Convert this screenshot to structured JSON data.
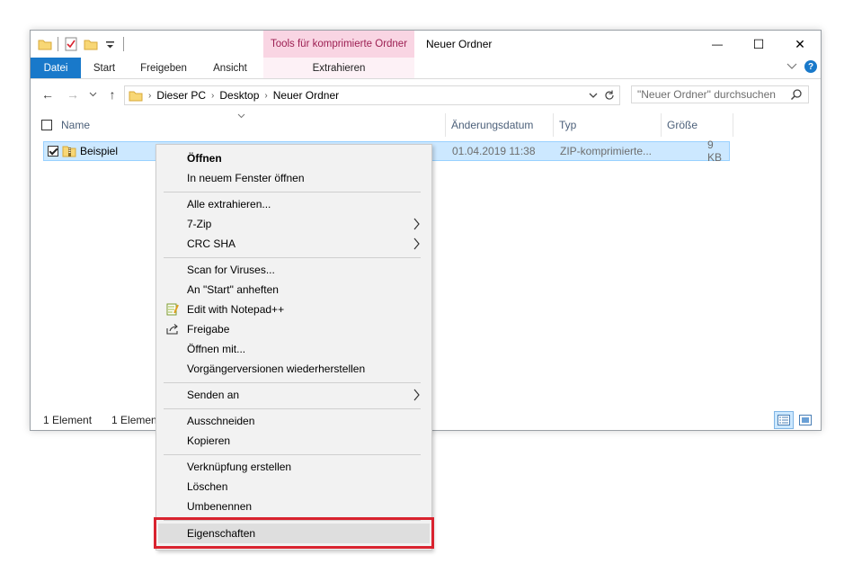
{
  "window": {
    "title": "Neuer Ordner",
    "context_tab_header": "Tools für komprimierte Ordner",
    "minimize_glyph": "—",
    "maximize_glyph": "☐",
    "close_glyph": "✕"
  },
  "ribbon": {
    "tabs": [
      "Datei",
      "Start",
      "Freigeben",
      "Ansicht"
    ],
    "context_tab": "Extrahieren",
    "help": "?"
  },
  "nav": {
    "back": "←",
    "forward": "→",
    "up": "↑",
    "breadcrumb": [
      "Dieser PC",
      "Desktop",
      "Neuer Ordner"
    ],
    "search_placeholder": "\"Neuer Ordner\" durchsuchen"
  },
  "columns": {
    "name": "Name",
    "date": "Änderungsdatum",
    "type": "Typ",
    "size": "Größe"
  },
  "file": {
    "name": "Beispiel",
    "date": "01.04.2019 11:38",
    "type": "ZIP-komprimierte...",
    "size": "9 KB"
  },
  "status": {
    "count": "1 Element",
    "selected": "1 Element"
  },
  "menu": {
    "open": "Öffnen",
    "open_new_window": "In neuem Fenster öffnen",
    "extract_all": "Alle extrahieren...",
    "seven_zip": "7-Zip",
    "crc_sha": "CRC SHA",
    "scan": "Scan for Viruses...",
    "pin_start": "An \"Start\" anheften",
    "edit_notepad": "Edit with Notepad++",
    "share": "Freigabe",
    "open_with": "Öffnen mit...",
    "restore_versions": "Vorgängerversionen wiederherstellen",
    "send_to": "Senden an",
    "cut": "Ausschneiden",
    "copy": "Kopieren",
    "create_shortcut": "Verknüpfung erstellen",
    "delete": "Löschen",
    "rename": "Umbenennen",
    "properties": "Eigenschaften"
  },
  "colors": {
    "file_tab": "#1979ca",
    "context_tab": "#f9d5e3",
    "selection": "#cce8ff",
    "highlight_border": "#d9232f"
  }
}
